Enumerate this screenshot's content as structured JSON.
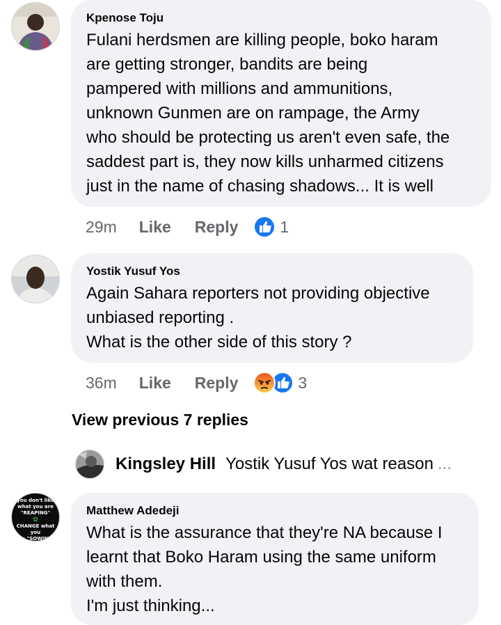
{
  "comments": [
    {
      "author": "Kpenose Toju",
      "lines": [
        "Fulani herdsmen are killing people, boko haram",
        "are getting stronger, bandits are being",
        "pampered with millions and ammunitions,",
        "unknown Gunmen are on rampage, the Army",
        "who should be protecting us aren't even safe, the",
        "saddest part is, they now kills unharmed citizens",
        "just in the name of chasing shadows... It is well"
      ],
      "time": "29m",
      "like_label": "Like",
      "reply_label": "Reply",
      "reactions": [
        "like-icon"
      ],
      "reaction_count": "1"
    },
    {
      "author": "Yostik Yusuf Yos",
      "lines": [
        "Again Sahara reporters not providing objective",
        "unbiased reporting .",
        "What is the other side of this story ?"
      ],
      "time": "36m",
      "like_label": "Like",
      "reply_label": "Reply",
      "reactions": [
        "angry-icon",
        "like-icon"
      ],
      "reaction_count": "3"
    },
    {
      "author": "Matthew Adedeji",
      "lines": [
        "What is the assurance that they're NA because I",
        "learnt that Boko Haram using the same uniform",
        "with them.",
        "I'm just thinking..."
      ]
    }
  ],
  "view_previous": "View previous 7 replies",
  "reply_preview": {
    "author": "Kingsley Hill",
    "text": "Yostik Yusuf Yos wat reason",
    "ellipsis": "..."
  },
  "avatar_matthew_lines": [
    "you don't like",
    "what you are",
    "\"REAPING\"",
    "CHANGE what you",
    "are \"SOWING\""
  ],
  "colors": {
    "bubble": "#f0f2f5",
    "meta": "#65676b",
    "like_blue": "#1877f2",
    "angry_orange": "#f7714b"
  }
}
